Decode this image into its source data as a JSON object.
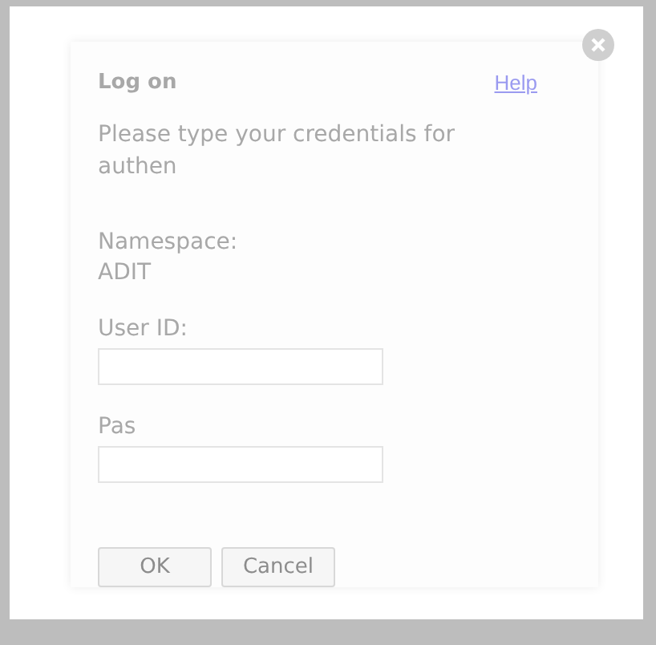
{
  "dialog": {
    "title": "Log on",
    "help_link": "Help",
    "message": "Please type your credentials for authen",
    "namespace_label": "Namespace:",
    "namespace_value": "ADIT",
    "fields": [
      {
        "label": "User ID:"
      },
      {
        "label": "Pas"
      }
    ],
    "buttons": [
      "OK",
      "Cancel"
    ]
  }
}
